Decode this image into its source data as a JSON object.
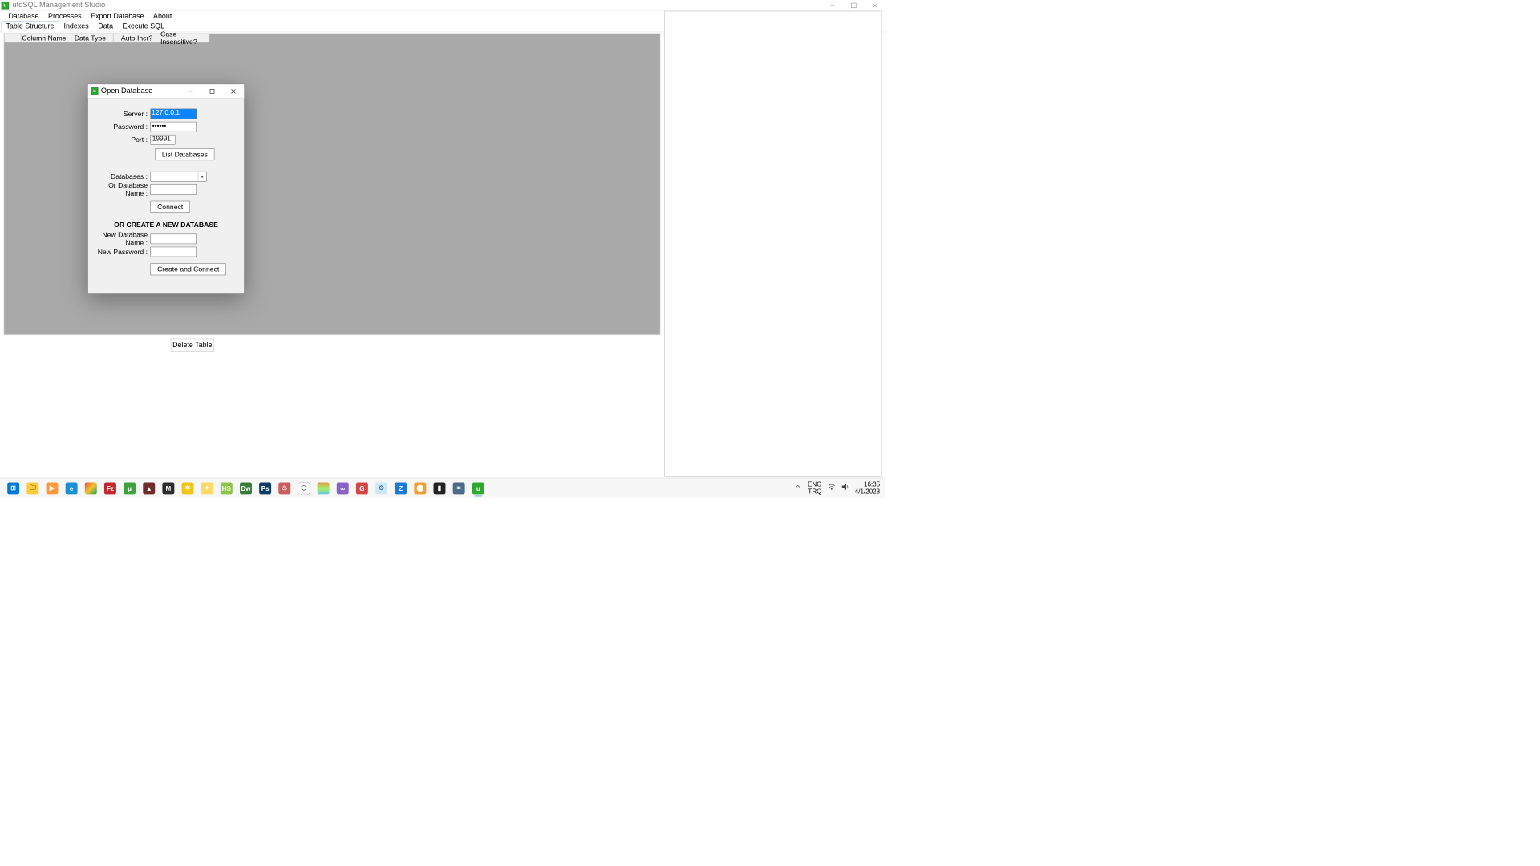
{
  "window": {
    "title": "ufoSQL Management Studio"
  },
  "menubar": [
    "Database",
    "Processes",
    "Export Database",
    "About"
  ],
  "tabs": [
    "Table Structure",
    "Indexes",
    "Data",
    "Execute SQL"
  ],
  "active_tab": 0,
  "table_headers": {
    "col1": "Column Name",
    "col2": "Data Type",
    "col3": "Auto Incr?",
    "col4": "Case Insensitive?"
  },
  "delete_table_btn": "Delete Table",
  "dialog": {
    "title": "Open Database",
    "server_label": "Server :",
    "server_value": "127.0.0.1",
    "password_label": "Password :",
    "password_value": "••••••",
    "port_label": "Port :",
    "port_value": "19991",
    "list_databases_btn": "List Databases",
    "databases_label": "Databases :",
    "or_db_name_label": "Or Database Name :",
    "connect_btn": "Connect",
    "section_head": "OR CREATE A NEW DATABASE",
    "new_db_name_label": "New Database Name :",
    "new_password_label": "New Password :",
    "create_connect_btn": "Create and Connect"
  },
  "systray": {
    "lang1": "ENG",
    "lang2": "TRQ",
    "time": "16:35",
    "date": "4/1/2023"
  }
}
